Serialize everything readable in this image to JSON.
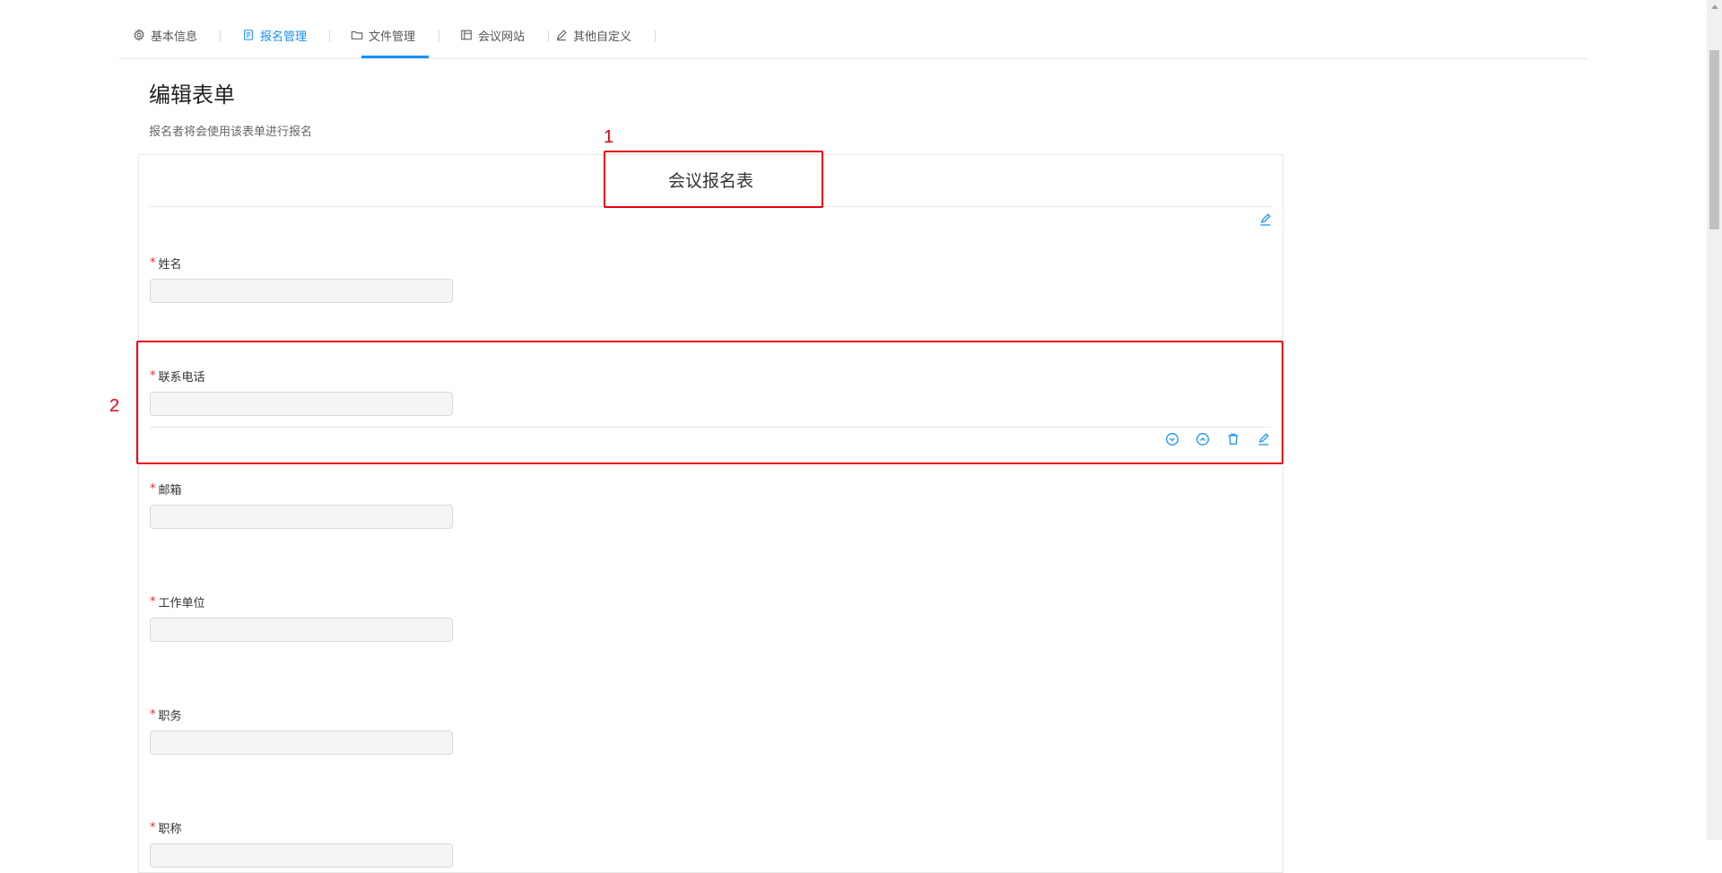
{
  "tabs": [
    {
      "label": "基本信息",
      "icon": "gear-icon"
    },
    {
      "label": "报名管理",
      "icon": "form-icon",
      "active": true
    },
    {
      "label": "文件管理",
      "icon": "folder-icon"
    },
    {
      "label": "会议网站",
      "icon": "layout-icon"
    },
    {
      "label": "其他自定义",
      "icon": "pencil-icon"
    }
  ],
  "page": {
    "title": "编辑表单",
    "description": "报名者将会使用该表单进行报名"
  },
  "form": {
    "title": "会议报名表",
    "fields": [
      {
        "label": "姓名",
        "required": "*"
      },
      {
        "label": "联系电话",
        "required": "*"
      },
      {
        "label": "邮箱",
        "required": "*"
      },
      {
        "label": "工作单位",
        "required": "*"
      },
      {
        "label": "职务",
        "required": "*"
      },
      {
        "label": "职称",
        "required": "*"
      }
    ]
  },
  "annotations": {
    "one": "1",
    "two": "2"
  },
  "colors": {
    "accent": "#1890ff",
    "annotation": "#e60012",
    "required": "#f5222d"
  }
}
